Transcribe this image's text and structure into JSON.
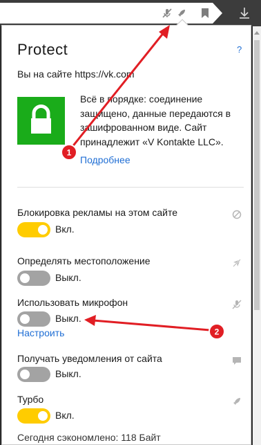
{
  "popup": {
    "title": "Protect",
    "help": "?",
    "site_text": "Вы на сайте https://vk.com",
    "secure_message": "Всё в порядке: соединение защищено, данные передаются в зашифрованном виде. Сайт принадлежит «V Kontakte LLC».",
    "more_link": "Подробнее"
  },
  "settings": [
    {
      "label": "Блокировка рекламы на этом сайте",
      "state": "Вкл.",
      "on": true,
      "icon": "block-icon"
    },
    {
      "label": "Определять местоположение",
      "state": "Выкл.",
      "on": false,
      "icon": "location-off-icon"
    },
    {
      "label": "Использовать микрофон",
      "state": "Выкл.",
      "on": false,
      "icon": "microphone-off-icon",
      "link": "Настроить"
    },
    {
      "label": "Получать уведомления от сайта",
      "state": "Выкл.",
      "on": false,
      "icon": "notification-icon"
    },
    {
      "label": "Турбо",
      "state": "Вкл.",
      "on": true,
      "icon": "rocket-icon"
    }
  ],
  "saved_text": "Сегодня сэкономлено: 118 Байт",
  "annotations": [
    {
      "number": "1"
    },
    {
      "number": "2"
    }
  ],
  "colors": {
    "accent_link": "#1f6ed4",
    "secure_green": "#1aac1a",
    "toggle_on": "#ffcc00",
    "toggle_off": "#a3a3a3",
    "annotation_red": "#e11e24"
  }
}
